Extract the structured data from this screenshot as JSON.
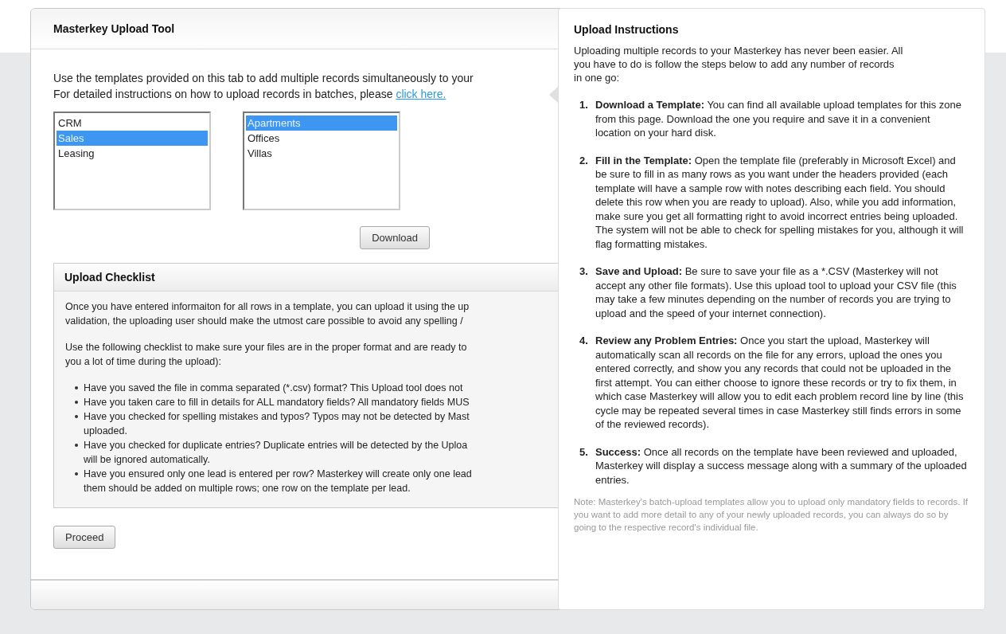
{
  "main_panel": {
    "title": "Masterkey Upload Tool",
    "intro_lines": [
      "Use the templates provided on this tab to add multiple records simultaneously to your",
      "For detailed instructions on how to upload records in batches, please"
    ],
    "link": "click here.",
    "listboxes": [
      {
        "items": [
          {
            "label": "CRM",
            "selected": false
          },
          {
            "label": "Sales",
            "selected": true
          },
          {
            "label": "Leasing",
            "selected": false
          }
        ]
      },
      {
        "items": [
          {
            "label": "Apartments",
            "selected": true
          },
          {
            "label": "Offices",
            "selected": false
          },
          {
            "label": "Villas",
            "selected": false
          }
        ]
      }
    ],
    "download_button": "Download",
    "checklist": {
      "title": "Upload Checklist",
      "paragraphs": [
        [
          "Once you have entered informaiton for all rows in a template, you can upload it using the up",
          "validation, the uploading user should make the utmost care possible to avoid any spelling /"
        ],
        [
          "Use the following checklist to make sure your files are in the proper format and are ready to",
          "you a lot of time during the upload):"
        ]
      ],
      "bullets": [
        [
          "Have you saved the file in comma separated (*.csv) format? This Upload tool does not"
        ],
        [
          "Have you taken care to fill in details for ALL mandatory fields? All mandatory fields MUS"
        ],
        [
          "Have you checked for spelling mistakes and typos? Typos may not be detected by Mast",
          "uploaded."
        ],
        [
          "Have you checked for duplicate entries? Duplicate entries will be detected by the Uploa",
          "will be ignored automatically."
        ],
        [
          "Have you ensured only one lead is entered per row? Masterkey will create only one lead",
          "them should be added on multiple rows; one row on the template per lead."
        ]
      ]
    },
    "proceed_button": "Proceed"
  },
  "instructions": {
    "title": "Upload Instructions",
    "intro": "Uploading multiple records to your Masterkey has never been easier. All you have to do is follow the steps below to add any number of records in one go:",
    "steps": [
      {
        "number": "1.",
        "text": "**Download a Template:** You can find all available upload templates for this zone from this page. Download the one you require and save it in a convenient location on your hard disk."
      },
      {
        "number": "2.",
        "text": "**Fill in the Template:** Open the template file (preferably in Microsoft Excel) and be sure to fill in as many rows as you want under the headers provided (each template will have a sample row with notes describing each field. You should delete this row when you are ready to upload). Also, while you add information, make sure you get all formatting right to avoid incorrect entries being uploaded. The system will not be able to check for spelling mistakes for you, although it will flag formatting mistakes."
      },
      {
        "number": "3.",
        "text": "**Save and Upload:** Be sure to save your file as a *.CSV (Masterkey will not accept any other file formats). Use this upload tool to upload your CSV file (this may take a few minutes depending on the number of records you are trying to upload and the speed of your internet connection)."
      },
      {
        "number": "4.",
        "text": "**Review any Problem Entries:** Once you start the upload, Masterkey will automatically scan all records on the file for any errors, upload the ones you entered correctly, and show you any records that could not be uploaded in the first attempt. You can either choose to ignore these records or try to fix them, in which case Masterkey will allow you to edit each problem record line by line (this cycle may be repeated several times in case Masterkey still finds errors in some of the reviewed records)."
      },
      {
        "number": "5.",
        "text": "**Success:** Once all records on the template have been reviewed and uploaded, Masterkey will display a success message along with a summary of the uploaded entries."
      }
    ],
    "note": "Note: Masterkey's batch-upload templates allow you to upload only mandatory fields to records. If you want to add more detail to any of your newly uploaded records, you can always do so by going to the respective record's individual file."
  }
}
